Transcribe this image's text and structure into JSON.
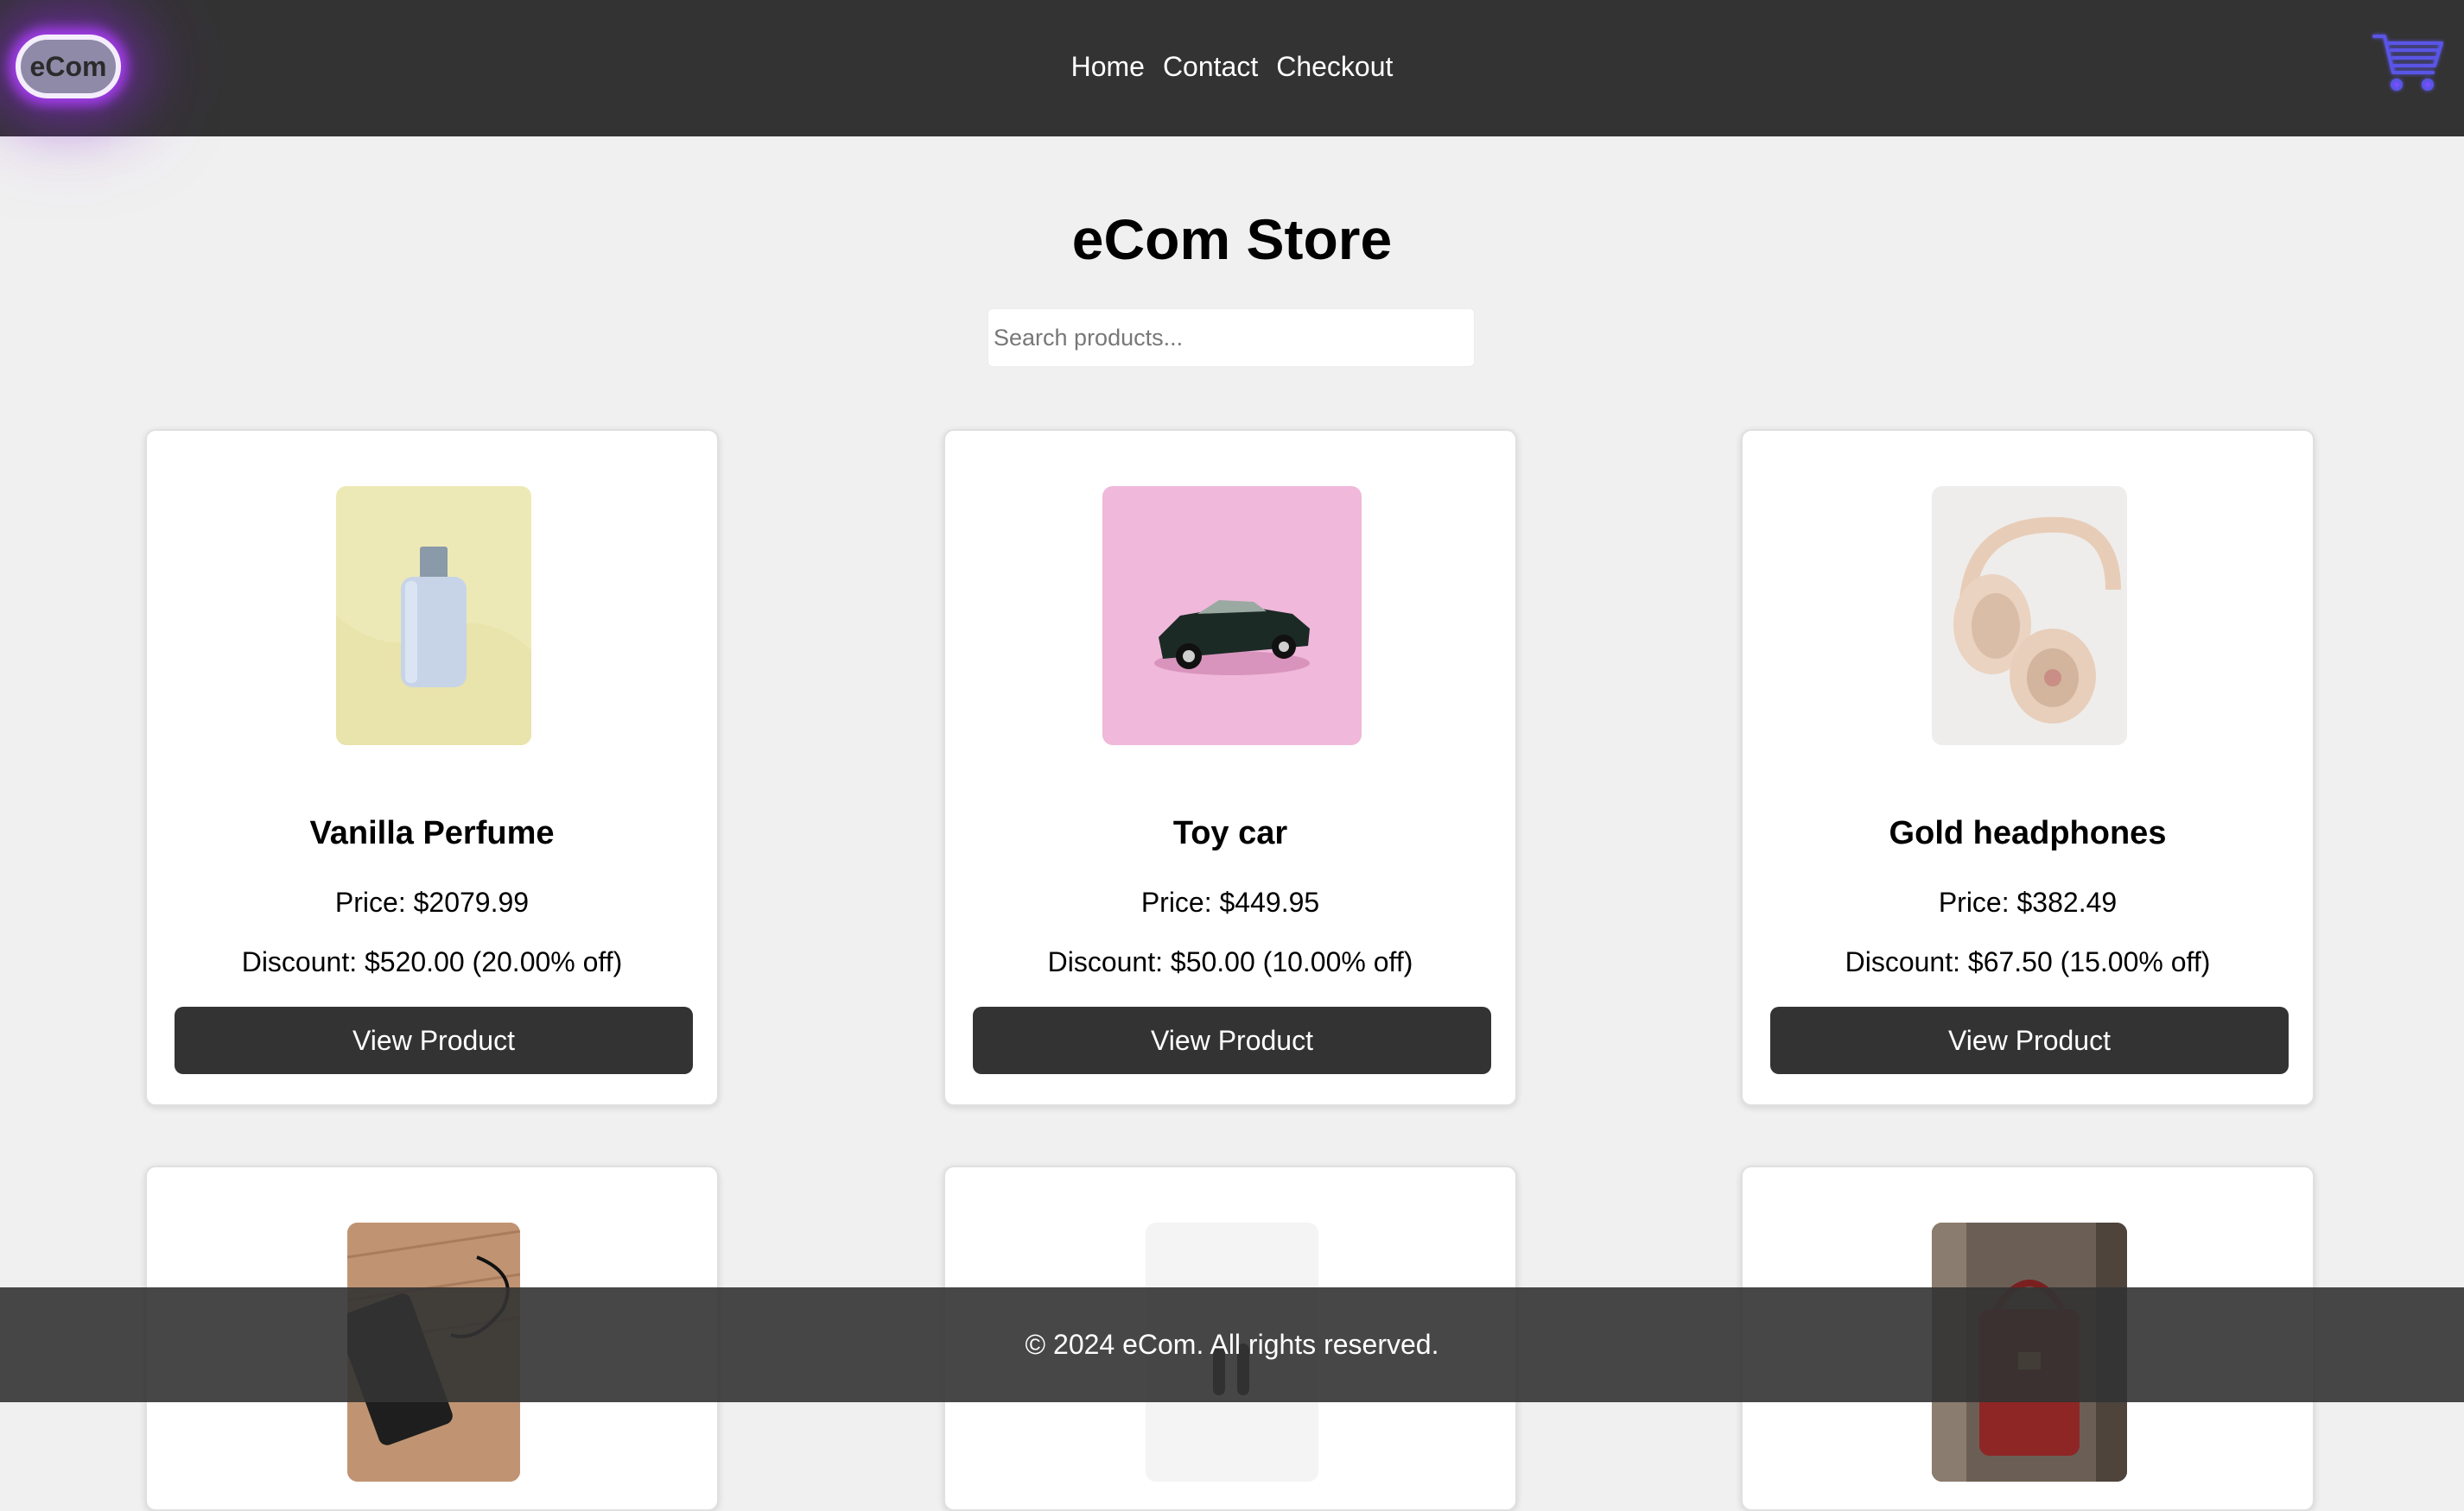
{
  "header": {
    "logo_text": "eCom",
    "nav": [
      {
        "label": "Home"
      },
      {
        "label": "Contact"
      },
      {
        "label": "Checkout"
      }
    ],
    "cart_icon": "shopping-cart-icon",
    "cart_color": "#5a55e6"
  },
  "main": {
    "title": "eCom Store",
    "search": {
      "placeholder": "Search products...",
      "value": ""
    }
  },
  "products": [
    {
      "name": "Vanilla Perfume",
      "price": "Price: $2079.99",
      "discount": "Discount: $520.00 (20.00% off)",
      "button": "View Product",
      "image": "perfume-bottle-image"
    },
    {
      "name": "Toy car",
      "price": "Price: $449.95",
      "discount": "Discount: $50.00 (10.00% off)",
      "button": "View Product",
      "image": "toy-car-image"
    },
    {
      "name": "Gold headphones",
      "price": "Price: $382.49",
      "discount": "Discount: $67.50 (15.00% off)",
      "button": "View Product",
      "image": "headphones-image"
    },
    {
      "image": "charger-on-wood-image"
    },
    {
      "image": "earbuds-image"
    },
    {
      "image": "red-handbag-image"
    }
  ],
  "footer": {
    "text": "© 2024 eCom. All rights reserved."
  },
  "colors": {
    "header_bg": "#333333",
    "page_bg": "#f0f0f0",
    "button_bg": "#333333",
    "logo_glow": "#b040ff"
  }
}
